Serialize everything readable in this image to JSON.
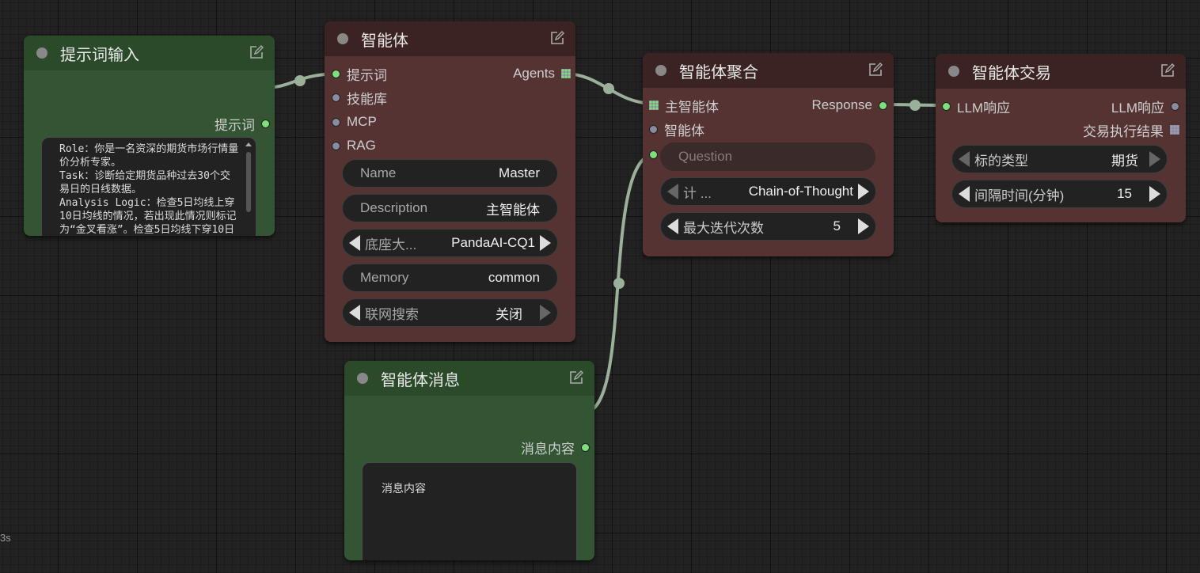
{
  "colors": {
    "green_node": "#335533",
    "red_node": "#553333",
    "link": "#9bb09b",
    "pin_active": "#7de07d"
  },
  "prompt_input": {
    "title": "提示词输入",
    "output_label": "提示词",
    "text": "Role：你是一名资深的期货市场行情量价分析专家。\nTask：诊断给定期货品种过去30个交易日的日线数据。\nAnalysis Logic：检查5日均线上穿10日均线的情况，若出现此情况则标记为“金叉看涨”。检查5日均线下穿10日"
  },
  "agent": {
    "title": "智能体",
    "inputs": [
      "提示词",
      "技能库",
      "MCP",
      "RAG"
    ],
    "output_label": "Agents",
    "name_label": "Name",
    "name_value": "Master",
    "desc_label": "Description",
    "desc_value": "主智能体",
    "model_label": "底座大...",
    "model_value": "PandaAI-CQ1",
    "memory_label": "Memory",
    "memory_value": "common",
    "search_label": "联网搜索",
    "search_value": "关闭"
  },
  "aggregate": {
    "title": "智能体聚合",
    "input_main": "主智能体",
    "input_agent": "智能体",
    "output_label": "Response",
    "question_placeholder": "Question",
    "method_label": "计 ...",
    "method_value": "Chain-of-Thought",
    "iter_label": "最大迭代次数",
    "iter_value": "5"
  },
  "trade": {
    "title": "智能体交易",
    "input_label": "LLM响应",
    "output_llm": "LLM响应",
    "output_result": "交易执行结果",
    "type_label": "标的类型",
    "type_value": "期货",
    "interval_label": "间隔时间(分钟)",
    "interval_value": "15"
  },
  "message": {
    "title": "智能体消息",
    "output_label": "消息内容",
    "text": "消息内容"
  },
  "footer": {
    "fps": "3s"
  }
}
